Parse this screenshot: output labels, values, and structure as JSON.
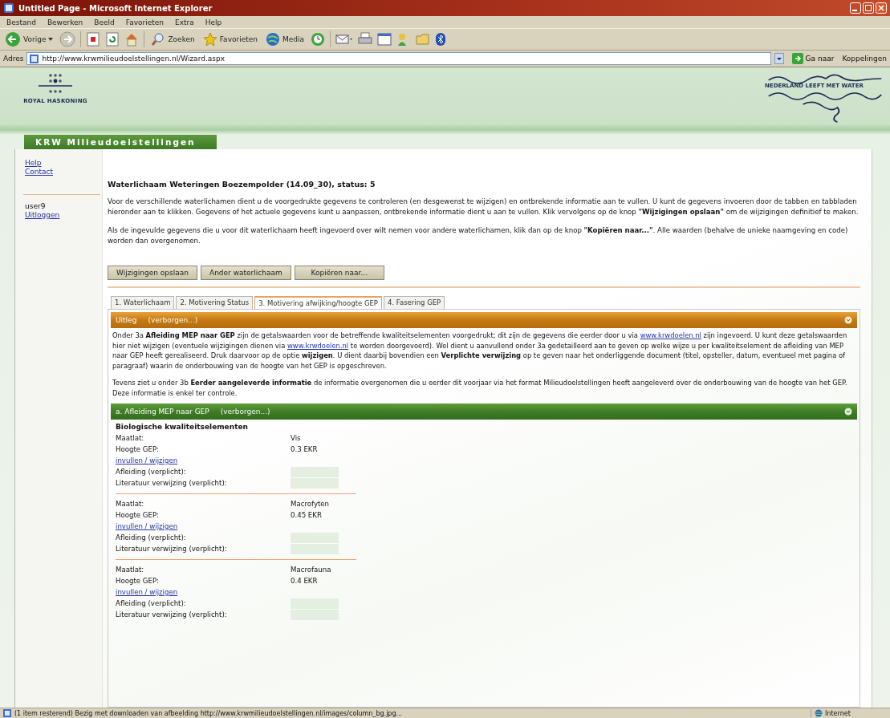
{
  "window": {
    "title": "Untitled Page - Microsoft Internet Explorer"
  },
  "menu": [
    "Bestand",
    "Bewerken",
    "Beeld",
    "Favorieten",
    "Extra",
    "Help"
  ],
  "toolbar": {
    "back_label": "Vorige",
    "search_label": "Zoeken",
    "favorites_label": "Favorieten",
    "media_label": "Media"
  },
  "address_bar": {
    "label": "Adres",
    "value": "http://www.krwmilieudoelstellingen.nl/Wizard.aspx",
    "go_label": "Ga naar",
    "links_label": "Koppelingen"
  },
  "header": {
    "left_logo_text": "ROYAL HASKONING",
    "right_logo_text": "NEDERLAND LEEFT MET WATER",
    "banner": "KRW Milieudoelstellingen"
  },
  "sidebar": {
    "links": [
      "Help",
      "Contact"
    ],
    "user": "user9",
    "logout": "Uitloggen"
  },
  "main": {
    "heading": "Waterlichaam Weteringen Boezempolder (14.09_30), status: 5",
    "paragraphs": [
      [
        {
          "kind": "text",
          "text": "Voor de verschillende waterlichamen dient u de voorgedrukte gegevens te controleren (en desgewenst te wijzigen) en ontbrekende informatie aan te vullen. U kunt de gegevens invoeren door de tabben en tabbladen hieronder aan te klikken. Gegevens of het actuele gegevens kunt u aanpassen, ontbrekende informatie dient u aan te vullen. Klik vervolgens op de knop **\"Wijzigingen opslaan\"** om de wijzigingen definitief te maken."
        }
      ],
      [
        {
          "kind": "text",
          "text": "Als de ingevulde gegevens die u voor dit waterlichaam heeft ingevoerd over wilt nemen voor andere waterlichamen, klik dan op de knop **\"Kopiëren naar...\"**. Alle waarden (behalve de unieke naamgeving en code) worden dan overgenomen."
        }
      ]
    ],
    "buttons": [
      "Wijzigingen opslaan",
      "Ander waterlichaam",
      "Kopiëren naar..."
    ],
    "tabs": [
      {
        "label": "1. Waterlichaam",
        "selected": false
      },
      {
        "label": "2. Motivering Status",
        "selected": false
      },
      {
        "label": "3. Motivering afwijking/hoogte GEP",
        "selected": true
      },
      {
        "label": "4. Fasering GEP",
        "selected": false
      }
    ]
  },
  "explanation": {
    "title": "Uitleg",
    "toggle": "(verborgen...)",
    "paragraphs": [
      [
        {
          "kind": "text",
          "text": "Onder 3a **Afleiding MEP naar GEP** zijn de getalswaarden voor de betreffende kwaliteitselementen voorgedrukt; dit zijn de gegevens die eerder door u via "
        },
        {
          "kind": "link",
          "text": "www.krwdoelen.nl"
        },
        {
          "kind": "text",
          "text": " zijn ingevoerd. U kunt deze getalswaarden hier niet wijzigen (eventuele wijzigingen dienen via "
        },
        {
          "kind": "link",
          "text": "www.krwdoelen.nl"
        },
        {
          "kind": "text",
          "text": " te worden doorgevoerd). Wel dient u aanvullend onder 3a gedetailleerd aan te geven op welke wijze u per kwaliteitselement de afleiding van MEP naar GEP heeft gerealiseerd. Druk daarvoor op de optie **wijzigen**. U dient daarbij bovendien een **Verplichte verwijzing** op te geven naar het onderliggende document (titel, opsteller, datum, eventueel met pagina of paragraaf) waarin de onderbouwing van de hoogte van het GEP is opgeschreven."
        }
      ],
      [
        {
          "kind": "text",
          "text": "Tevens ziet u onder 3b **Eerder aangeleverde informatie** de informatie overgenomen die u eerder dit voorjaar via het format Milieudoelstellingen heeft aangeleverd over de onderbouwing van de hoogte van het GEP. Deze informatie is enkel ter controle."
        }
      ]
    ]
  },
  "section": {
    "title": "a. Afleiding MEP naar GEP",
    "toggle": "(verborgen...)",
    "subheading": "Biologische kwaliteitselementen",
    "items": [
      {
        "maatlat_label": "Maatlat:",
        "maatlat": "Vis",
        "gep_label": "Hoogte GEP:",
        "gep": "0.3 EKR",
        "link": "invullen / wijzigen",
        "afleiding_label": "Afleiding (verplicht):",
        "literatuur_label": "Literatuur verwijzing (verplicht):"
      },
      {
        "maatlat_label": "Maatlat:",
        "maatlat": "Macrofyten",
        "gep_label": "Hoogte GEP:",
        "gep": "0.45 EKR",
        "link": "invullen / wijzigen",
        "afleiding_label": "Afleiding (verplicht):",
        "literatuur_label": "Literatuur verwijzing (verplicht):"
      },
      {
        "maatlat_label": "Maatlat:",
        "maatlat": "Macrofauna",
        "gep_label": "Hoogte GEP:",
        "gep": "0.4 EKR",
        "link": "invullen / wijzigen",
        "afleiding_label": "Afleiding (verplicht):",
        "literatuur_label": "Literatuur verwijzing (verplicht):"
      }
    ]
  },
  "status_bar": {
    "text": "(1 item resterend) Bezig met downloaden van afbeelding http://www.krwmilieudoelstellingen.nl/images/column_bg.jpg...",
    "zone": "Internet"
  }
}
